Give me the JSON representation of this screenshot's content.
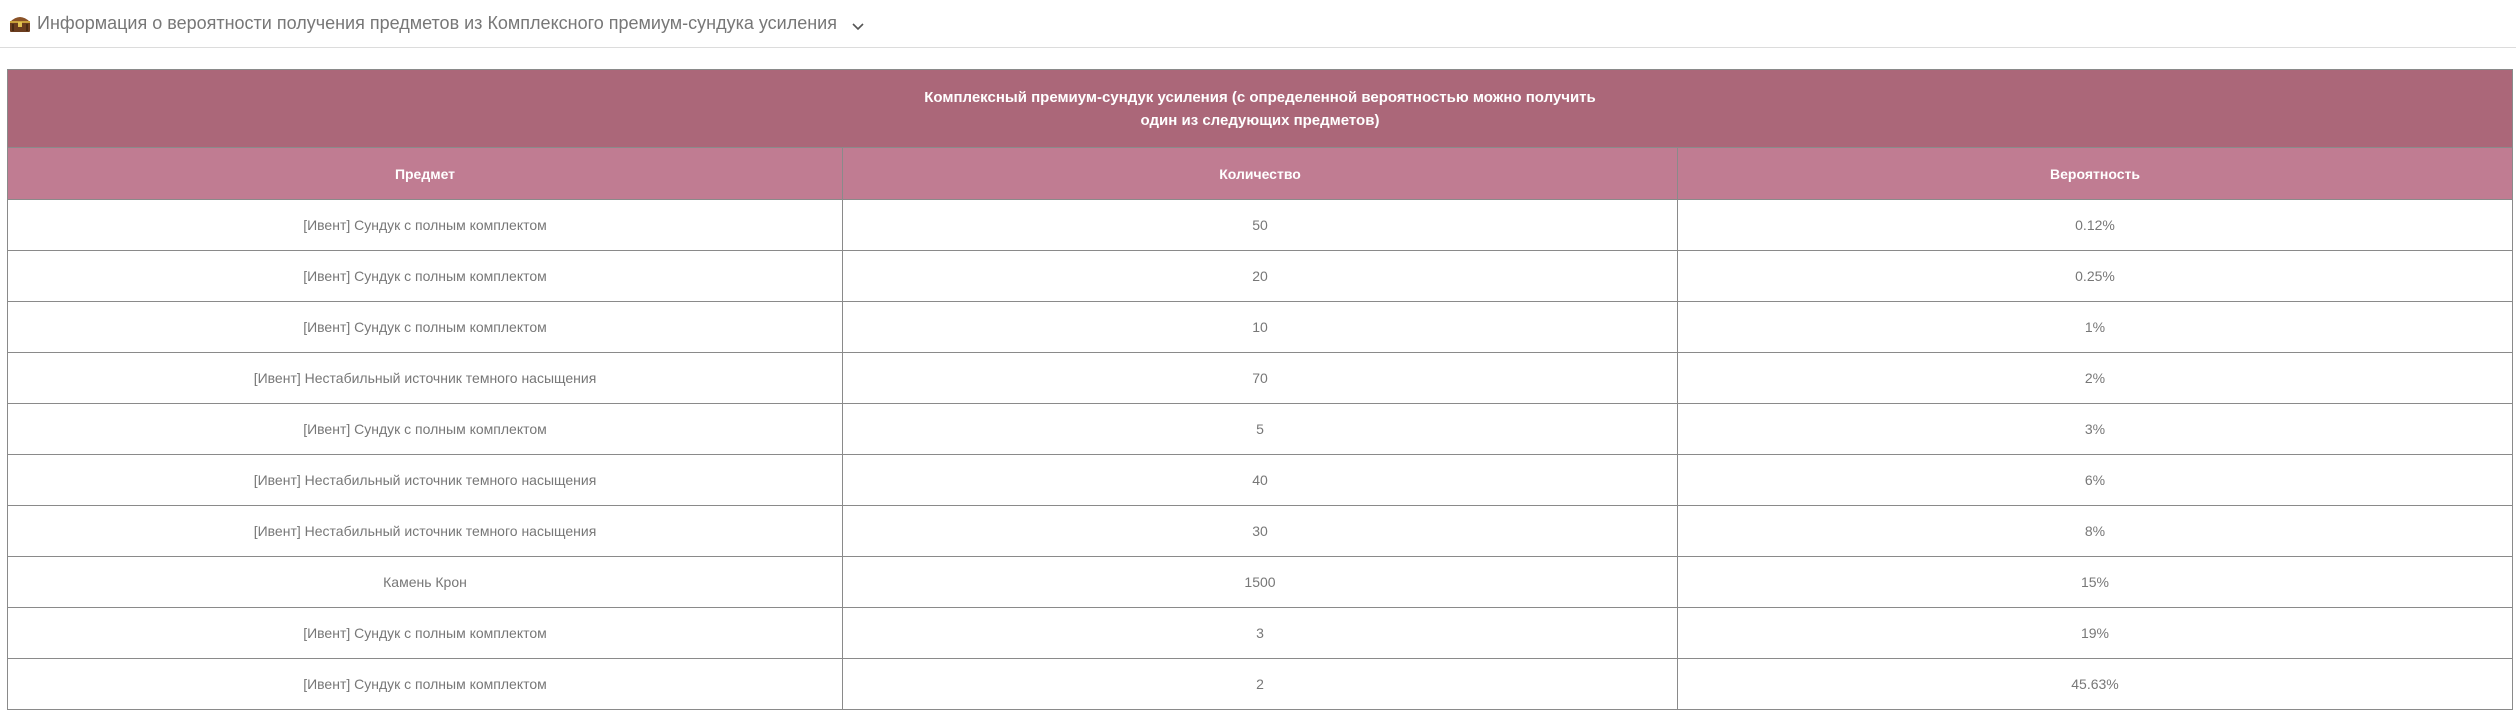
{
  "accordion": {
    "title": "Информация о вероятности получения предметов из Комплексного премиум-сундука усиления",
    "icon": "treasure-chest-icon",
    "expand_icon": "chevron-down-icon"
  },
  "table": {
    "caption_line1": "Комплексный премиум-сундук усиления (с определенной вероятностью можно получить",
    "caption_line2": "один из следующих предметов)",
    "headers": [
      "Предмет",
      "Количество",
      "Вероятность"
    ],
    "rows": [
      {
        "item": "[Ивент] Сундук с полным комплектом",
        "qty": "50",
        "prob": "0.12%"
      },
      {
        "item": "[Ивент] Сундук с полным комплектом",
        "qty": "20",
        "prob": "0.25%"
      },
      {
        "item": "[Ивент] Сундук с полным комплектом",
        "qty": "10",
        "prob": "1%"
      },
      {
        "item": "[Ивент] Нестабильный источник темного насыщения",
        "qty": "70",
        "prob": "2%"
      },
      {
        "item": "[Ивент] Сундук с полным комплектом",
        "qty": "5",
        "prob": "3%"
      },
      {
        "item": "[Ивент] Нестабильный источник темного насыщения",
        "qty": "40",
        "prob": "6%"
      },
      {
        "item": "[Ивент] Нестабильный источник темного насыщения",
        "qty": "30",
        "prob": "8%"
      },
      {
        "item": "Камень Крон",
        "qty": "1500",
        "prob": "15%"
      },
      {
        "item": "[Ивент] Сундук с полным комплектом",
        "qty": "3",
        "prob": "19%"
      },
      {
        "item": "[Ивент] Сундук с полным комплектом",
        "qty": "2",
        "prob": "45.63%"
      }
    ]
  },
  "colors": {
    "caption_bg": "#ab6779",
    "header_bg": "#c07c92",
    "text": "#777777"
  }
}
